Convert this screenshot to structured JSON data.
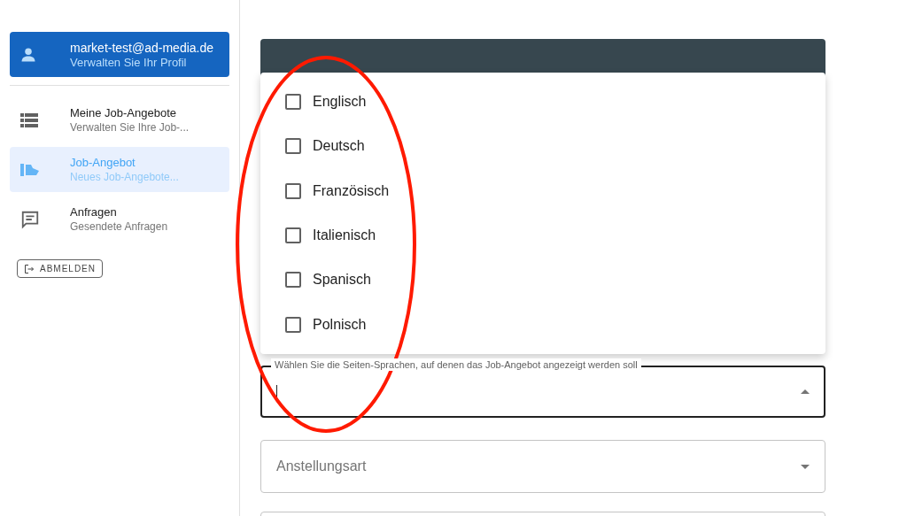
{
  "profile": {
    "email": "market-test@ad-media.de",
    "subtitle": "Verwalten Sie Ihr Profil"
  },
  "nav": [
    {
      "kind": "list",
      "title": "Meine Job-Angebote",
      "subtitle": "Verwalten Sie Ihre Job-...",
      "selected": false
    },
    {
      "kind": "hand",
      "title": "Job-Angebot",
      "subtitle": "Neues Job-Angebote...",
      "selected": true
    },
    {
      "kind": "chat",
      "title": "Anfragen",
      "subtitle": "Gesendete Anfragen",
      "selected": false
    }
  ],
  "logout": "ABMELDEN",
  "languages": [
    {
      "label": "Englisch",
      "checked": false
    },
    {
      "label": "Deutsch",
      "checked": false
    },
    {
      "label": "Französisch",
      "checked": false
    },
    {
      "label": "Italienisch",
      "checked": false
    },
    {
      "label": "Spanisch",
      "checked": false
    },
    {
      "label": "Polnisch",
      "checked": false
    }
  ],
  "language_field": {
    "label": "Wählen Sie die Seiten-Sprachen, auf denen das Job-Angebot angezeigt werden soll",
    "expanded": true
  },
  "employment_field": {
    "placeholder": "Anstellungsart",
    "expanded": false
  }
}
